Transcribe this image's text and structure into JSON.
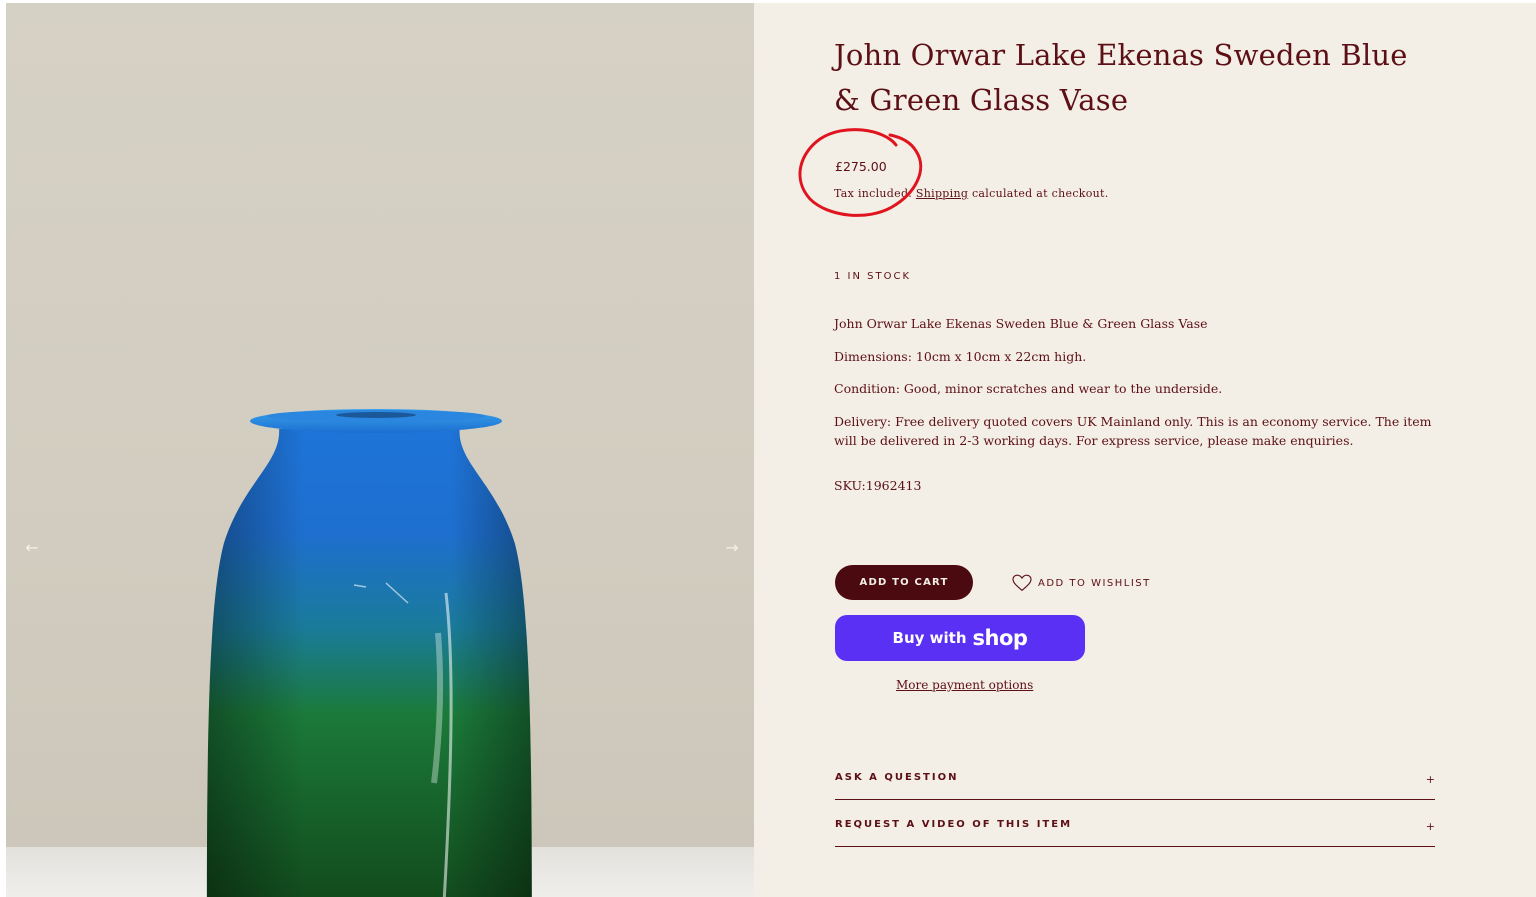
{
  "gallery": {
    "image_alt": "John Orwar Lake Ekenas Sweden Blue & Green Glass Vase",
    "prev_icon": "arrow-left-icon",
    "next_icon": "arrow-right-icon",
    "prev_glyph": "←",
    "next_glyph": "→"
  },
  "product": {
    "title": "John Orwar Lake Ekenas Sweden Blue & Green Glass Vase",
    "price": "£275.00",
    "tax_prefix": "Tax included. ",
    "shipping_link": "Shipping",
    "tax_suffix": " calculated at checkout.",
    "stock": "1 IN STOCK",
    "description": [
      "John Orwar Lake Ekenas Sweden Blue & Green Glass Vase",
      "Dimensions: 10cm x 10cm x 22cm high.",
      "Condition: Good, minor scratches and wear to the underside.",
      "Delivery: Free delivery quoted covers UK Mainland only. This is an economy service. The item will be delivered in 2-3 working days. For express service, please make enquiries."
    ],
    "sku": "SKU:1962413"
  },
  "actions": {
    "add_to_cart": "ADD TO CART",
    "add_to_wishlist": "ADD TO WISHLIST",
    "wishlist_icon": "heart-icon",
    "shop_pay_prefix": "Buy with",
    "shop_pay_brand": "shop",
    "more_payment": "More payment options"
  },
  "accordions": [
    {
      "label": "ASK A QUESTION",
      "icon": "+"
    },
    {
      "label": "REQUEST A VIDEO OF THIS ITEM",
      "icon": "+"
    }
  ],
  "colors": {
    "brand_text": "#5c0f15",
    "panel_bg": "#f4efe6",
    "cart_button": "#4a0a10",
    "shop_pay": "#5a31f4",
    "annotation": "#e0141e"
  }
}
